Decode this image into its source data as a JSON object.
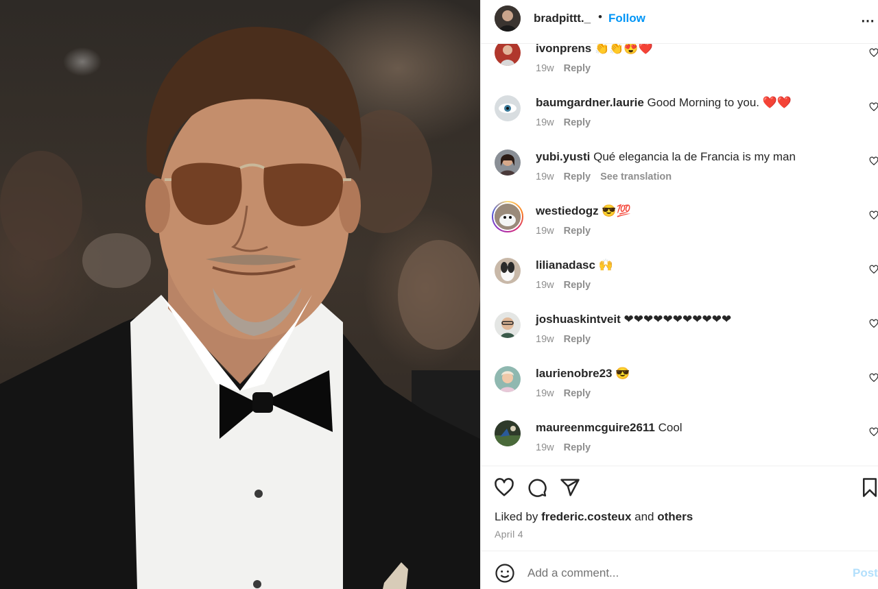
{
  "header": {
    "username": "bradpittt._",
    "separator": "•",
    "follow_label": "Follow",
    "more_label": "⋯"
  },
  "comments": [
    {
      "username": "ivonprens",
      "text": "👏👏😍❤️",
      "time": "19w",
      "reply": "Reply",
      "extra": ""
    },
    {
      "username": "baumgardner.laurie",
      "text": "Good Morning to you. ❤️❤️",
      "time": "19w",
      "reply": "Reply",
      "extra": ""
    },
    {
      "username": "yubi.yusti",
      "text": "Qué elegancia la de Francia is my man",
      "time": "19w",
      "reply": "Reply",
      "extra": "See translation"
    },
    {
      "username": "westiedogz",
      "text": "😎💯",
      "time": "19w",
      "reply": "Reply",
      "extra": ""
    },
    {
      "username": "lilianadasc",
      "text": "🙌",
      "time": "19w",
      "reply": "Reply",
      "extra": ""
    },
    {
      "username": "joshuaskintveit",
      "text": "❤❤❤❤❤❤❤❤❤❤❤",
      "time": "19w",
      "reply": "Reply",
      "extra": ""
    },
    {
      "username": "laurienobre23",
      "text": "😎",
      "time": "19w",
      "reply": "Reply",
      "extra": ""
    },
    {
      "username": "maureenmcguire2611",
      "text": "Cool",
      "time": "19w",
      "reply": "Reply",
      "extra": ""
    }
  ],
  "likes": {
    "prefix": "Liked by",
    "user": "frederic.costeux",
    "conj": "and",
    "others": "others"
  },
  "post_date": "April 4",
  "add_comment": {
    "placeholder": "Add a comment...",
    "post_label": "Post"
  },
  "colors": {
    "accent": "#0095f6",
    "post_disabled": "#b2dffc",
    "text": "#262626",
    "muted": "#8e8e8e"
  }
}
